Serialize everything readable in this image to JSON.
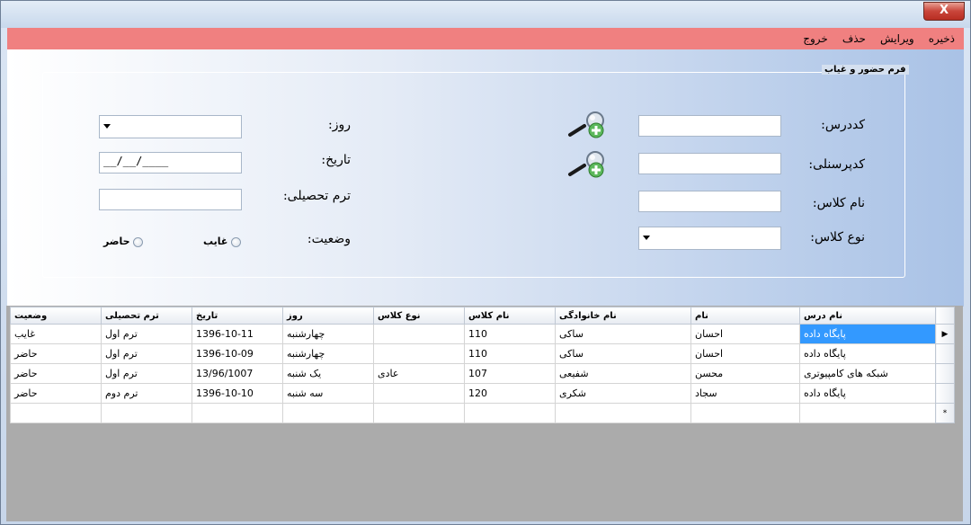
{
  "window": {
    "close_glyph": "X"
  },
  "menu": {
    "items": [
      "ذخیره",
      "ویرایش",
      "حذف",
      "خروج"
    ]
  },
  "form": {
    "group_title": "فرم حضور و غیاب",
    "labels": {
      "course_code": "کددرس:",
      "personnel_code": "کدپرسنلی:",
      "class_name": "نام کلاس:",
      "class_type": "نوع کلاس:",
      "day": "روز:",
      "date": "تاریخ:",
      "term": "ترم تحصیلی:",
      "status": "وضعیت:"
    },
    "fields": {
      "course_code": "",
      "personnel_code": "",
      "class_name": "",
      "class_type": "",
      "day": "",
      "date": "__/__/____",
      "term": ""
    },
    "radios": {
      "absent": "غایب",
      "present": "حاضر"
    },
    "icons": {
      "lookup": "search-add-icon"
    }
  },
  "grid": {
    "columns": [
      "نام درس",
      "نام",
      "نام خانوادگی",
      "نام کلاس",
      "نوع کلاس",
      "روز",
      "تاریخ",
      "ترم تحصیلی",
      "وضعیت"
    ],
    "rows": [
      [
        "پایگاه داده",
        "احسان",
        "ساکی",
        "110",
        "",
        "چهارشنبه",
        "1396-10-11",
        "ترم اول",
        "غایب"
      ],
      [
        "پایگاه داده",
        "احسان",
        "ساکی",
        "110",
        "",
        "چهارشنبه",
        "1396-10-09",
        "ترم اول",
        "حاضر"
      ],
      [
        "شبکه های کامپیوتری",
        "محسن",
        "شفیعی",
        "107",
        "عادی",
        "یک شنبه",
        "13/96/1007",
        "ترم اول",
        "حاضر"
      ],
      [
        "پایگاه داده",
        "سجاد",
        "شکری",
        "120",
        "",
        "سه شنبه",
        "1396-10-10",
        "ترم دوم",
        "حاضر"
      ]
    ],
    "current_row_glyph": "▶",
    "new_row_glyph": "*",
    "selection_color": "#3399ff"
  },
  "colors": {
    "menubar": "#f08080"
  }
}
